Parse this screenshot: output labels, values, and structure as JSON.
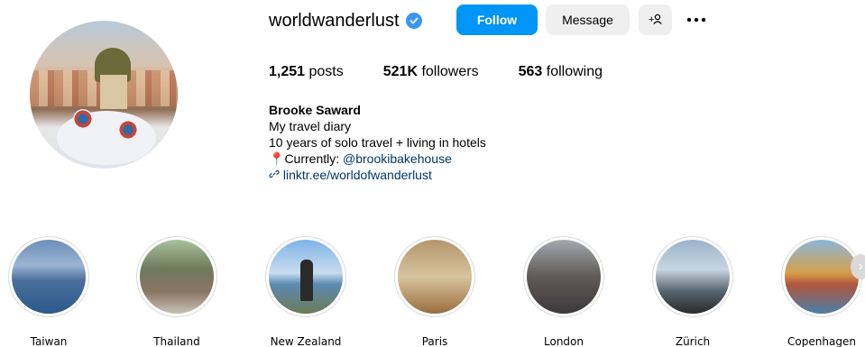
{
  "profile": {
    "username": "worldwanderlust",
    "verified": true,
    "buttons": {
      "follow": "Follow",
      "message": "Message",
      "add_user_icon": "+8",
      "more_icon": "•••"
    },
    "stats": {
      "posts_count": "1,251",
      "posts_label": "posts",
      "followers_count": "521K",
      "followers_label": "followers",
      "following_count": "563",
      "following_label": "following"
    },
    "bio": {
      "name": "Brooke Saward",
      "line1": "My travel diary",
      "line2": "10 years of solo travel + living in hotels",
      "currently_prefix": "Currently: ",
      "mention": "@brookibakehouse",
      "link": "linktr.ee/worldofwanderlust"
    }
  },
  "highlights": [
    {
      "label": "Taiwan"
    },
    {
      "label": "Thailand"
    },
    {
      "label": "New Zealand"
    },
    {
      "label": "Paris"
    },
    {
      "label": "London"
    },
    {
      "label": "Zürich"
    },
    {
      "label": "Copenhagen"
    }
  ],
  "colors": {
    "follow_button": "#0095f6",
    "verified_badge": "#3897f0",
    "secondary_button": "#efefef",
    "link_text": "#00376b"
  }
}
